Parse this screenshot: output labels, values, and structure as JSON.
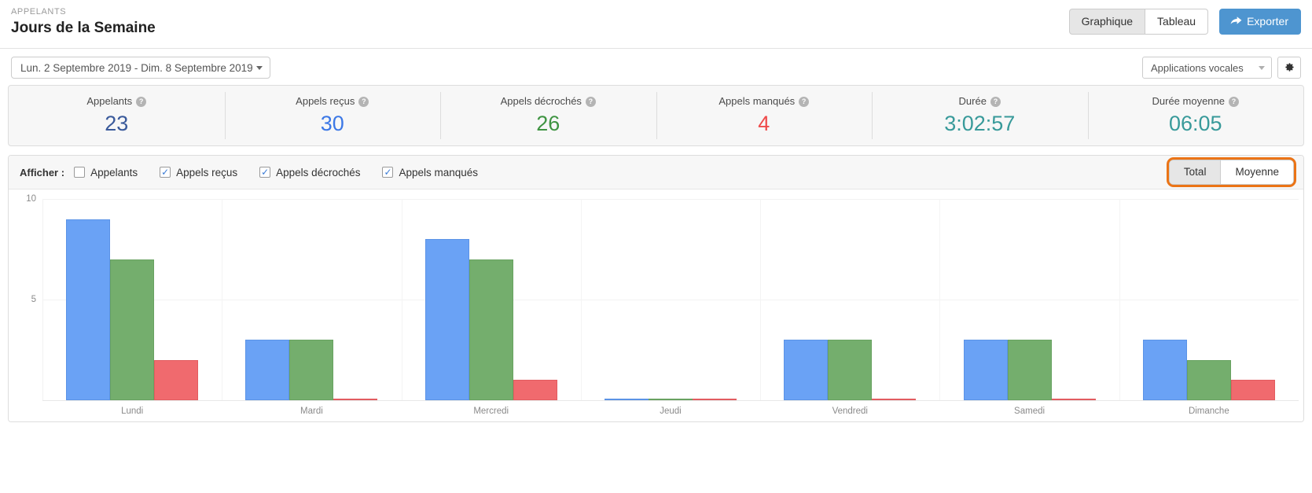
{
  "header": {
    "eyebrow": "APPELANTS",
    "title": "Jours de la Semaine",
    "view_chart_label": "Graphique",
    "view_table_label": "Tableau",
    "export_label": "Exporter",
    "active_view": "Graphique"
  },
  "filters": {
    "date_range": "Lun. 2 Septembre 2019 - Dim. 8 Septembre 2019",
    "source_select": "Applications vocales",
    "settings_icon": "gear-icon"
  },
  "kpis": [
    {
      "label": "Appelants",
      "value": "23",
      "color": "#3a5a9b"
    },
    {
      "label": "Appels reçus",
      "value": "30",
      "color": "#3c78e6"
    },
    {
      "label": "Appels décrochés",
      "value": "26",
      "color": "#3f9442"
    },
    {
      "label": "Appels manqués",
      "value": "4",
      "color": "#ef4b4b"
    },
    {
      "label": "Durée",
      "value": "3:02:57",
      "color": "#389a9a"
    },
    {
      "label": "Durée moyenne",
      "value": "06:05",
      "color": "#389a9a"
    }
  ],
  "chart_toolbar": {
    "afficher_label": "Afficher :",
    "checkboxes": [
      {
        "label": "Appelants",
        "checked": false,
        "mark": ""
      },
      {
        "label": "Appels reçus",
        "checked": true,
        "mark": "✓"
      },
      {
        "label": "Appels décrochés",
        "checked": true,
        "mark": "✓"
      },
      {
        "label": "Appels manqués",
        "checked": true,
        "mark": "✓"
      }
    ],
    "aggregate_total_label": "Total",
    "aggregate_average_label": "Moyenne",
    "aggregate_selected": "Total",
    "focus_ring_color": "#eb7416"
  },
  "chart_data": {
    "type": "bar",
    "title": "Jours de la Semaine",
    "xlabel": "",
    "ylabel": "",
    "ylim": [
      0,
      10
    ],
    "yticks": [
      5,
      10
    ],
    "grid": true,
    "legend": "none",
    "categories": [
      "Lundi",
      "Mardi",
      "Mercredi",
      "Jeudi",
      "Vendredi",
      "Samedi",
      "Dimanche"
    ],
    "series": [
      {
        "name": "Appels reçus",
        "color": "#6aa2f5",
        "values": [
          9,
          3,
          8,
          0,
          3,
          3,
          3
        ]
      },
      {
        "name": "Appels décrochés",
        "color": "#74ae6d",
        "values": [
          7,
          3,
          7,
          0,
          3,
          3,
          2
        ]
      },
      {
        "name": "Appels manqués",
        "color": "#f06a6e",
        "values": [
          2,
          0,
          1,
          0,
          0,
          0,
          1
        ]
      }
    ]
  }
}
